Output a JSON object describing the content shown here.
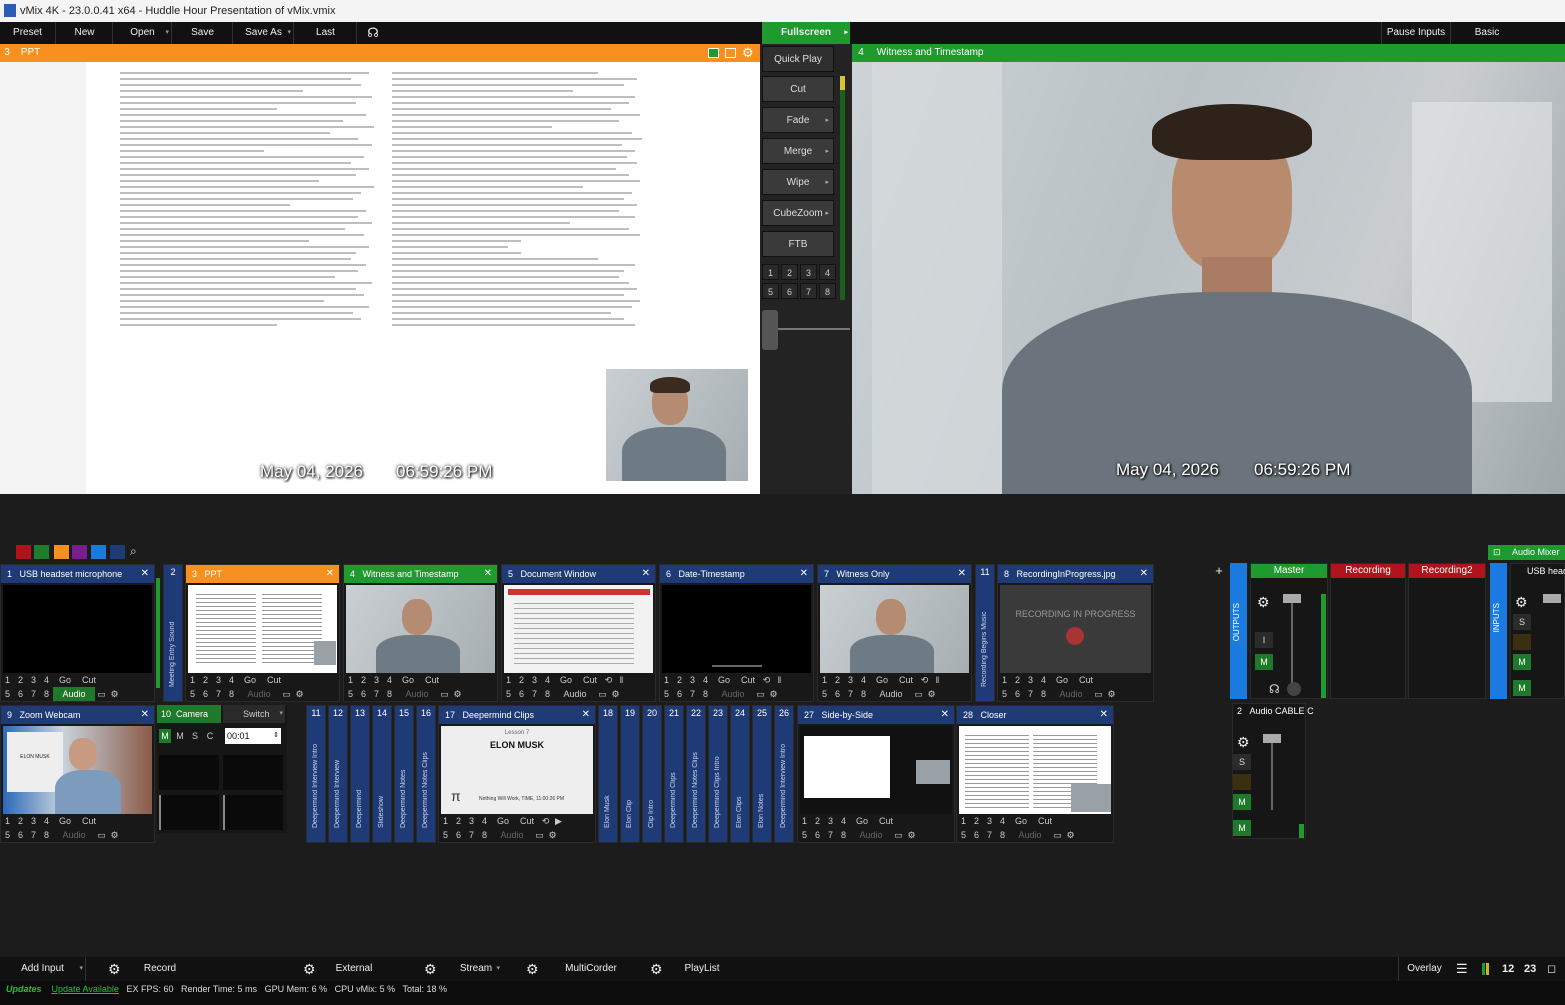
{
  "window": {
    "title": "vMix 4K - 23.0.0.41 x64 - Huddle Hour Presentation of vMix.vmix"
  },
  "menu": {
    "preset": "Preset",
    "new": "New",
    "open": "Open",
    "save": "Save",
    "save_as": "Save As",
    "last": "Last",
    "fullscreen": "Fullscreen",
    "pause_inputs": "Pause Inputs",
    "basic": "Basic"
  },
  "preview": {
    "number": "3",
    "title": "PPT",
    "date": "May 04, 2026",
    "time": "06:59:26 PM"
  },
  "program": {
    "number": "4",
    "title": "Witness and Timestamp",
    "date": "May 04, 2026",
    "time": "06:59:26 PM"
  },
  "transitions": {
    "quick_play": "Quick Play",
    "cut": "Cut",
    "fade": "Fade",
    "merge": "Merge",
    "wipe": "Wipe",
    "cubezoom": "CubeZoom",
    "ftb": "FTB",
    "numbers": [
      "1",
      "2",
      "3",
      "4",
      "5",
      "6",
      "7",
      "8"
    ]
  },
  "colors": {
    "swatches": [
      "#b0131c",
      "#1e7d2a",
      "#f7901e",
      "#7a1d8f",
      "#1b7ae0",
      "#1e3b78"
    ],
    "orange": "#f7901e",
    "green": "#1e9a2f",
    "blue": "#1e3b78"
  },
  "row_controls": {
    "nums_top": [
      "1",
      "2",
      "3",
      "4"
    ],
    "go": "Go",
    "cut": "Cut",
    "nums_bottom": [
      "5",
      "6",
      "7",
      "8"
    ],
    "audio": "Audio"
  },
  "inputs_row1": [
    {
      "number": "1",
      "title": "USB headset microphone"
    },
    {
      "number": "3",
      "title": "PPT"
    },
    {
      "number": "4",
      "title": "Witness and Timestamp"
    },
    {
      "number": "5",
      "title": "Document Window"
    },
    {
      "number": "6",
      "title": "Date-Timestamp"
    },
    {
      "number": "7",
      "title": "Witness Only"
    },
    {
      "number": "8",
      "title": "RecordingInProgress.jpg"
    }
  ],
  "recording_text": "RECORDING IN PROGRESS",
  "narrow_row1": [
    {
      "number": "2",
      "label": "Meeting Entry Sound"
    },
    {
      "number": "11",
      "label": "Recording Begins Music"
    }
  ],
  "inputs_row2": [
    {
      "number": "9",
      "title": "Zoom Webcam"
    },
    {
      "number": "17",
      "title": "Deepermind Clips"
    },
    {
      "number": "27",
      "title": "Side-by-Side"
    },
    {
      "number": "28",
      "title": "Closer"
    }
  ],
  "camera_panel": {
    "number": "10",
    "title": "Camera",
    "switch": "Switch",
    "m1": "M",
    "m2": "M",
    "s": "S",
    "c": "C",
    "time": "00:01"
  },
  "clip": {
    "name": "ELON MUSK",
    "footer": "Nothing Will Work, TIME, 11:00:26 PM",
    "subtitle": "Lesson 7",
    "pi": "π"
  },
  "zoom_name": "ELON MUSK",
  "narrow_row2": [
    {
      "number": "11",
      "label": "Deepermind Interview Intro"
    },
    {
      "number": "12",
      "label": "Deepermind Interview"
    },
    {
      "number": "13",
      "label": "Deepermind"
    },
    {
      "number": "14",
      "label": "Slideshow"
    },
    {
      "number": "15",
      "label": "Deepermind Notes"
    },
    {
      "number": "16",
      "label": "Deepermind Notes Clips"
    },
    {
      "number": "18",
      "label": "Elon Musk"
    },
    {
      "number": "19",
      "label": "Elon Clip"
    },
    {
      "number": "20",
      "label": "Clip Intro"
    },
    {
      "number": "21",
      "label": "Deepermind Clips"
    },
    {
      "number": "22",
      "label": "Deepermind Notes Clips"
    },
    {
      "number": "23",
      "label": "Deepermind Clips Intro"
    },
    {
      "number": "24",
      "label": "Elon Clips"
    },
    {
      "number": "25",
      "label": "Elon Notes"
    },
    {
      "number": "26",
      "label": "Deepermind Interview Intro"
    }
  ],
  "audio": {
    "mixer": "Audio Mixer",
    "master": "Master",
    "recording": "Recording",
    "recording2": "Recording2",
    "usb": "USB head",
    "outputs": "OUTPUTS",
    "inputs": "INPUTS",
    "cable_number": "2",
    "cable": "Audio CABLE C",
    "s": "S",
    "m": "M",
    "i": "I",
    "mono": "M"
  },
  "bottom": {
    "add_input": "Add Input",
    "record": "Record",
    "external": "External",
    "stream": "Stream",
    "multicorder": "MultiCorder",
    "playlist": "PlayList",
    "overlay": "Overlay",
    "ov1": "1",
    "ov2": "2",
    "ov3": "2",
    "ov4": "3"
  },
  "status": {
    "status": "Updates",
    "update": "Update Available",
    "fps_label": "EX FPS:",
    "fps": "60",
    "render_label": "Render Time:",
    "render": "5 ms",
    "gpu_label": "GPU Mem:",
    "gpu": "6 %",
    "cpu_label": "CPU vMix:",
    "cpu": "5 %",
    "total_label": "Total:",
    "total": "18 %"
  }
}
